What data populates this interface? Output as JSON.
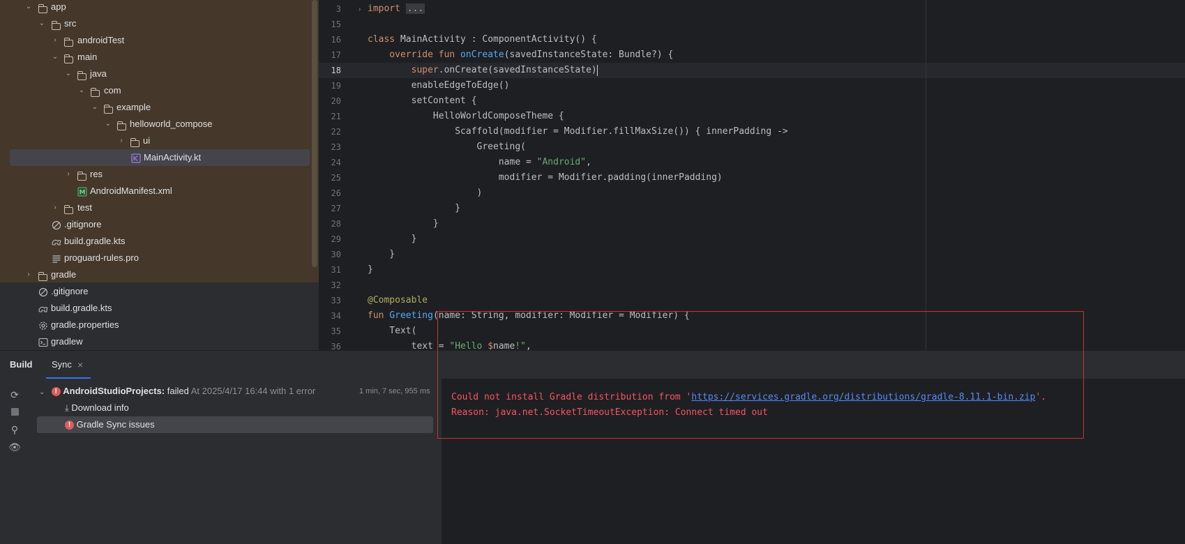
{
  "project_tree": {
    "items": [
      {
        "label": "app",
        "icon": "folder-icon",
        "expanded": true
      },
      {
        "label": "src",
        "icon": "folder-icon",
        "expanded": true
      },
      {
        "label": "androidTest",
        "icon": "folder-icon",
        "expanded": false
      },
      {
        "label": "main",
        "icon": "folder-icon",
        "expanded": true
      },
      {
        "label": "java",
        "icon": "folder-icon",
        "expanded": true
      },
      {
        "label": "com",
        "icon": "folder-icon",
        "expanded": true
      },
      {
        "label": "example",
        "icon": "folder-icon",
        "expanded": true
      },
      {
        "label": "helloworld_compose",
        "icon": "folder-icon",
        "expanded": true
      },
      {
        "label": "ui",
        "icon": "folder-icon",
        "expanded": false
      },
      {
        "label": "MainActivity.kt",
        "icon": "kotlin-file-icon",
        "selected": true
      },
      {
        "label": "res",
        "icon": "folder-icon",
        "expanded": false
      },
      {
        "label": "AndroidManifest.xml",
        "icon": "manifest-icon"
      },
      {
        "label": "test",
        "icon": "folder-icon",
        "expanded": false
      },
      {
        "label": ".gitignore",
        "icon": "ignore-file-icon"
      },
      {
        "label": "build.gradle.kts",
        "icon": "gradle-file-icon"
      },
      {
        "label": "proguard-rules.pro",
        "icon": "text-file-icon"
      },
      {
        "label": "gradle",
        "icon": "folder-icon",
        "expanded": false
      },
      {
        "label": ".gitignore",
        "icon": "ignore-file-icon"
      },
      {
        "label": "build.gradle.kts",
        "icon": "gradle-file-icon"
      },
      {
        "label": "gradle.properties",
        "icon": "settings-file-icon"
      },
      {
        "label": "gradlew",
        "icon": "terminal-file-icon"
      }
    ]
  },
  "editor": {
    "current_line": "18",
    "line_numbers": [
      "3",
      "15",
      "16",
      "17",
      "18",
      "19",
      "20",
      "21",
      "22",
      "23",
      "24",
      "25",
      "26",
      "27",
      "28",
      "29",
      "30",
      "31",
      "32",
      "33",
      "34",
      "35",
      "36"
    ],
    "code": {
      "l3_import": "import",
      "l3_fold": "...",
      "l16_class": "class",
      "l16_rest": " MainActivity : ComponentActivity() {",
      "l17_override": "    override",
      "l17_fun": " fun",
      "l17_name": " onCreate",
      "l17_rest": "(savedInstanceState: Bundle?) {",
      "l18_super": "        super",
      "l18_rest": ".onCreate(savedInstanceState)",
      "l19": "        enableEdgeToEdge()",
      "l20": "        setContent {",
      "l21": "            HelloWorldComposeTheme {",
      "l22": "                Scaffold(modifier = Modifier.fillMaxSize()) { innerPadding ->",
      "l23": "                    Greeting(",
      "l24_a": "                        name = ",
      "l24_str": "\"Android\"",
      "l24_b": ",",
      "l25": "                        modifier = Modifier.padding(innerPadding)",
      "l26": "                    )",
      "l27": "                }",
      "l28": "            }",
      "l29": "        }",
      "l30": "    }",
      "l31": "}",
      "l32": "",
      "l33": "@Composable",
      "l34_fun": "fun",
      "l34_name": " Greeting",
      "l34_rest": "(name: String, modifier: Modifier = Modifier) {",
      "l35": "    Text(",
      "l36_a": "        text = ",
      "l36_str1": "\"Hello ",
      "l36_var": "$",
      "l36_name": "name",
      "l36_str2": "!\"",
      "l36_b": ","
    }
  },
  "build_panel": {
    "tabs": {
      "build": "Build",
      "sync": "Sync",
      "close": "×"
    },
    "result": {
      "project": "AndroidStudioProjects:",
      "status": "failed",
      "detail": "At 2025/4/17 16:44 with 1 error",
      "duration": "1 min, 7 sec, 955 ms"
    },
    "children": {
      "download": "Download info",
      "issues": "Gradle Sync issues"
    },
    "console": {
      "line1_prefix": "Could not install Gradle distribution from '",
      "line1_link": "https://services.gradle.org/distributions/gradle-8.11.1-bin.zip",
      "line1_suffix": "'.",
      "line2": "Reason: java.net.SocketTimeoutException: Connect timed out"
    }
  },
  "colors": {
    "error": "#f75464",
    "highlight_box": "#d0302f",
    "link": "#548af7",
    "accent": "#3574f0"
  }
}
